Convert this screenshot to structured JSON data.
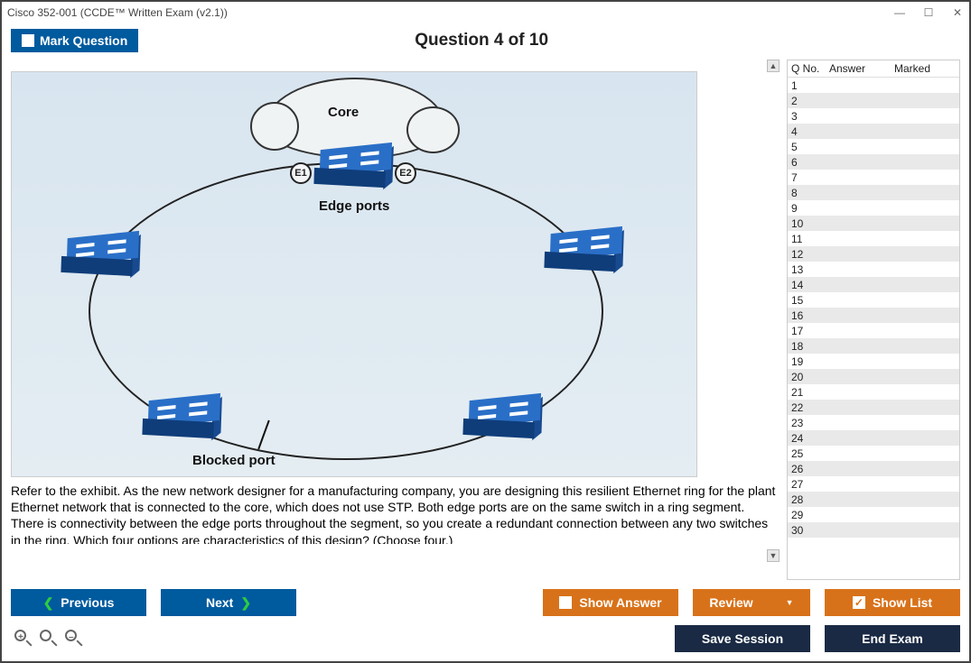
{
  "window": {
    "title": "Cisco 352-001 (CCDE™ Written Exam (v2.1))"
  },
  "header": {
    "mark_label": "Mark Question",
    "question_label": "Question 4 of 10"
  },
  "exhibit": {
    "cloud_label": "Core",
    "edge_label": "Edge ports",
    "e1": "E1",
    "e2": "E2",
    "blocked_label": "Blocked port"
  },
  "question": {
    "text": "Refer to the exhibit. As the new network designer for a manufacturing company, you are designing this resilient Ethernet ring for the plant Ethernet network that is connected to the core, which does not use STP. Both edge ports are on the same switch in a ring segment. There is connectivity between the edge ports throughout the segment, so you create a redundant connection between any two switches in the ring. Which four options are characteristics of this design? (Choose four.)"
  },
  "qlist": {
    "headers": {
      "qno": "Q No.",
      "answer": "Answer",
      "marked": "Marked"
    },
    "rows": [
      {
        "n": "1"
      },
      {
        "n": "2"
      },
      {
        "n": "3"
      },
      {
        "n": "4"
      },
      {
        "n": "5"
      },
      {
        "n": "6"
      },
      {
        "n": "7"
      },
      {
        "n": "8"
      },
      {
        "n": "9"
      },
      {
        "n": "10"
      },
      {
        "n": "11"
      },
      {
        "n": "12"
      },
      {
        "n": "13"
      },
      {
        "n": "14"
      },
      {
        "n": "15"
      },
      {
        "n": "16"
      },
      {
        "n": "17"
      },
      {
        "n": "18"
      },
      {
        "n": "19"
      },
      {
        "n": "20"
      },
      {
        "n": "21"
      },
      {
        "n": "22"
      },
      {
        "n": "23"
      },
      {
        "n": "24"
      },
      {
        "n": "25"
      },
      {
        "n": "26"
      },
      {
        "n": "27"
      },
      {
        "n": "28"
      },
      {
        "n": "29"
      },
      {
        "n": "30"
      }
    ]
  },
  "buttons": {
    "previous": "Previous",
    "next": "Next",
    "show_answer": "Show Answer",
    "review": "Review",
    "show_list": "Show List",
    "save_session": "Save Session",
    "end_exam": "End Exam"
  }
}
